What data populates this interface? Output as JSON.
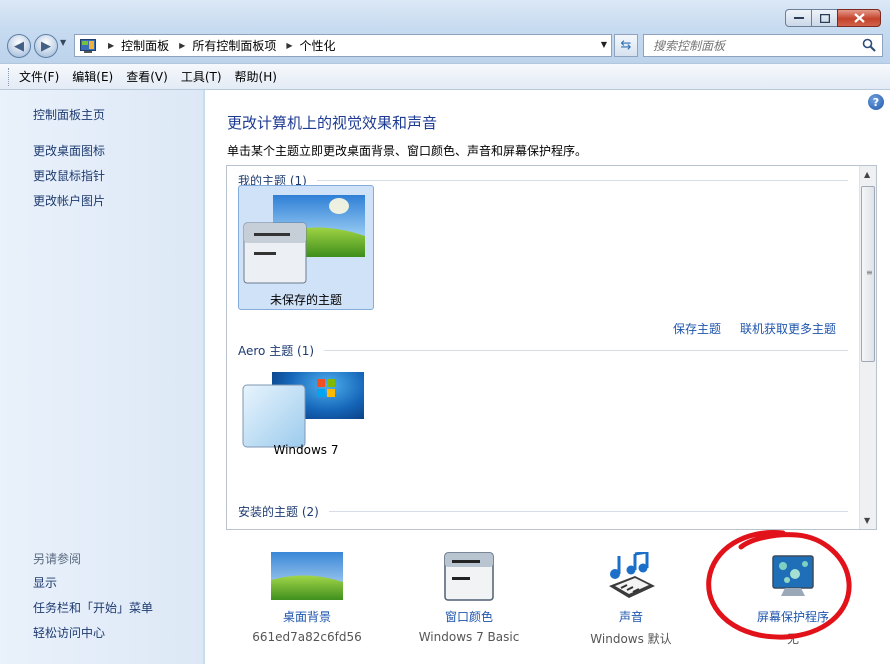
{
  "address_bar": {
    "breadcrumbs": [
      "控制面板",
      "所有控制面板项",
      "个性化"
    ]
  },
  "search": {
    "placeholder": "搜索控制面板"
  },
  "menu": [
    "文件(F)",
    "编辑(E)",
    "查看(V)",
    "工具(T)",
    "帮助(H)"
  ],
  "sidebar": {
    "items": [
      {
        "label": "控制面板主页"
      },
      {
        "label": "更改桌面图标"
      },
      {
        "label": "更改鼠标指针"
      },
      {
        "label": "更改帐户图片"
      }
    ],
    "see_also_title": "另请参阅",
    "see_also": [
      {
        "label": "显示"
      },
      {
        "label": "任务栏和「开始」菜单"
      },
      {
        "label": "轻松访问中心"
      }
    ]
  },
  "main": {
    "title": "更改计算机上的视觉效果和声音",
    "description": "单击某个主题立即更改桌面背景、窗口颜色、声音和屏幕保护程序。",
    "groups": [
      {
        "header": "我的主题 (1)",
        "themes": [
          {
            "label": "未保存的主题",
            "selected": true
          }
        ]
      },
      {
        "header": "Aero 主题 (1)",
        "themes": [
          {
            "label": "Windows 7",
            "selected": false
          }
        ]
      },
      {
        "header": "安装的主题 (2)",
        "themes": []
      }
    ],
    "links": {
      "save_theme": "保存主题",
      "get_more": "联机获取更多主题"
    }
  },
  "bottom": [
    {
      "label": "桌面背景",
      "sub": "661ed7a82c6fd56",
      "icon": "desktop-background-icon"
    },
    {
      "label": "窗口颜色",
      "sub": "Windows 7 Basic",
      "icon": "window-color-icon"
    },
    {
      "label": "声音",
      "sub": "Windows 默认",
      "icon": "sound-icon"
    },
    {
      "label": "屏幕保护程序",
      "sub": "无",
      "icon": "screensaver-icon"
    }
  ],
  "colors": {
    "accent_link": "#1e55ad",
    "title_blue": "#1e3b93",
    "annotation_red": "#e2121a"
  }
}
